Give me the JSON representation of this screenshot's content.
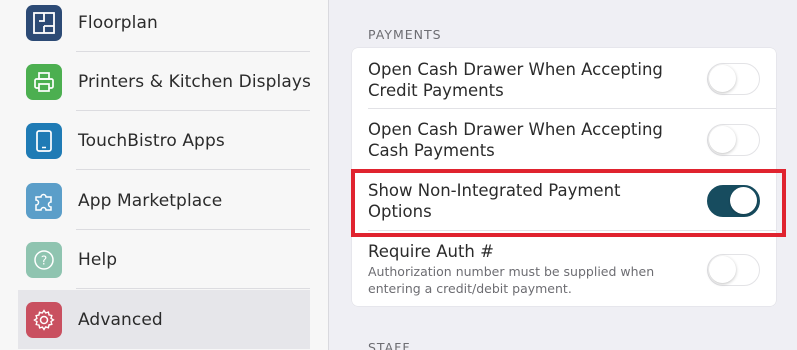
{
  "sidebar": {
    "items": [
      {
        "label": "Floorplan",
        "icon": "floorplan-icon",
        "color": "#2c4a75"
      },
      {
        "label": "Printers & Kitchen Displays",
        "icon": "printer-icon",
        "color": "#4caf50"
      },
      {
        "label": "TouchBistro Apps",
        "icon": "tablet-icon",
        "color": "#1f7bb5"
      },
      {
        "label": "App Marketplace",
        "icon": "puzzle-icon",
        "color": "#5b9ec9"
      },
      {
        "label": "Help",
        "icon": "help-icon",
        "color": "#8fc4b0"
      },
      {
        "label": "Advanced",
        "icon": "gear-icon",
        "color": "#c95060",
        "selected": true
      }
    ]
  },
  "payments": {
    "header": "PAYMENTS",
    "rows": [
      {
        "title": "Open Cash Drawer When Accepting Credit Payments",
        "toggle": "off"
      },
      {
        "title": "Open Cash Drawer When Accepting Cash Payments",
        "toggle": "off"
      },
      {
        "title": "Show Non-Integrated Payment Options",
        "toggle": "on"
      },
      {
        "title": "Require Auth #",
        "subtitle": "Authorization number must be supplied when entering a credit/debit payment.",
        "toggle": "off"
      }
    ]
  },
  "staff": {
    "header": "STAFF"
  },
  "colors": {
    "toggle_on": "#174c5f",
    "highlight": "#e0232f"
  }
}
